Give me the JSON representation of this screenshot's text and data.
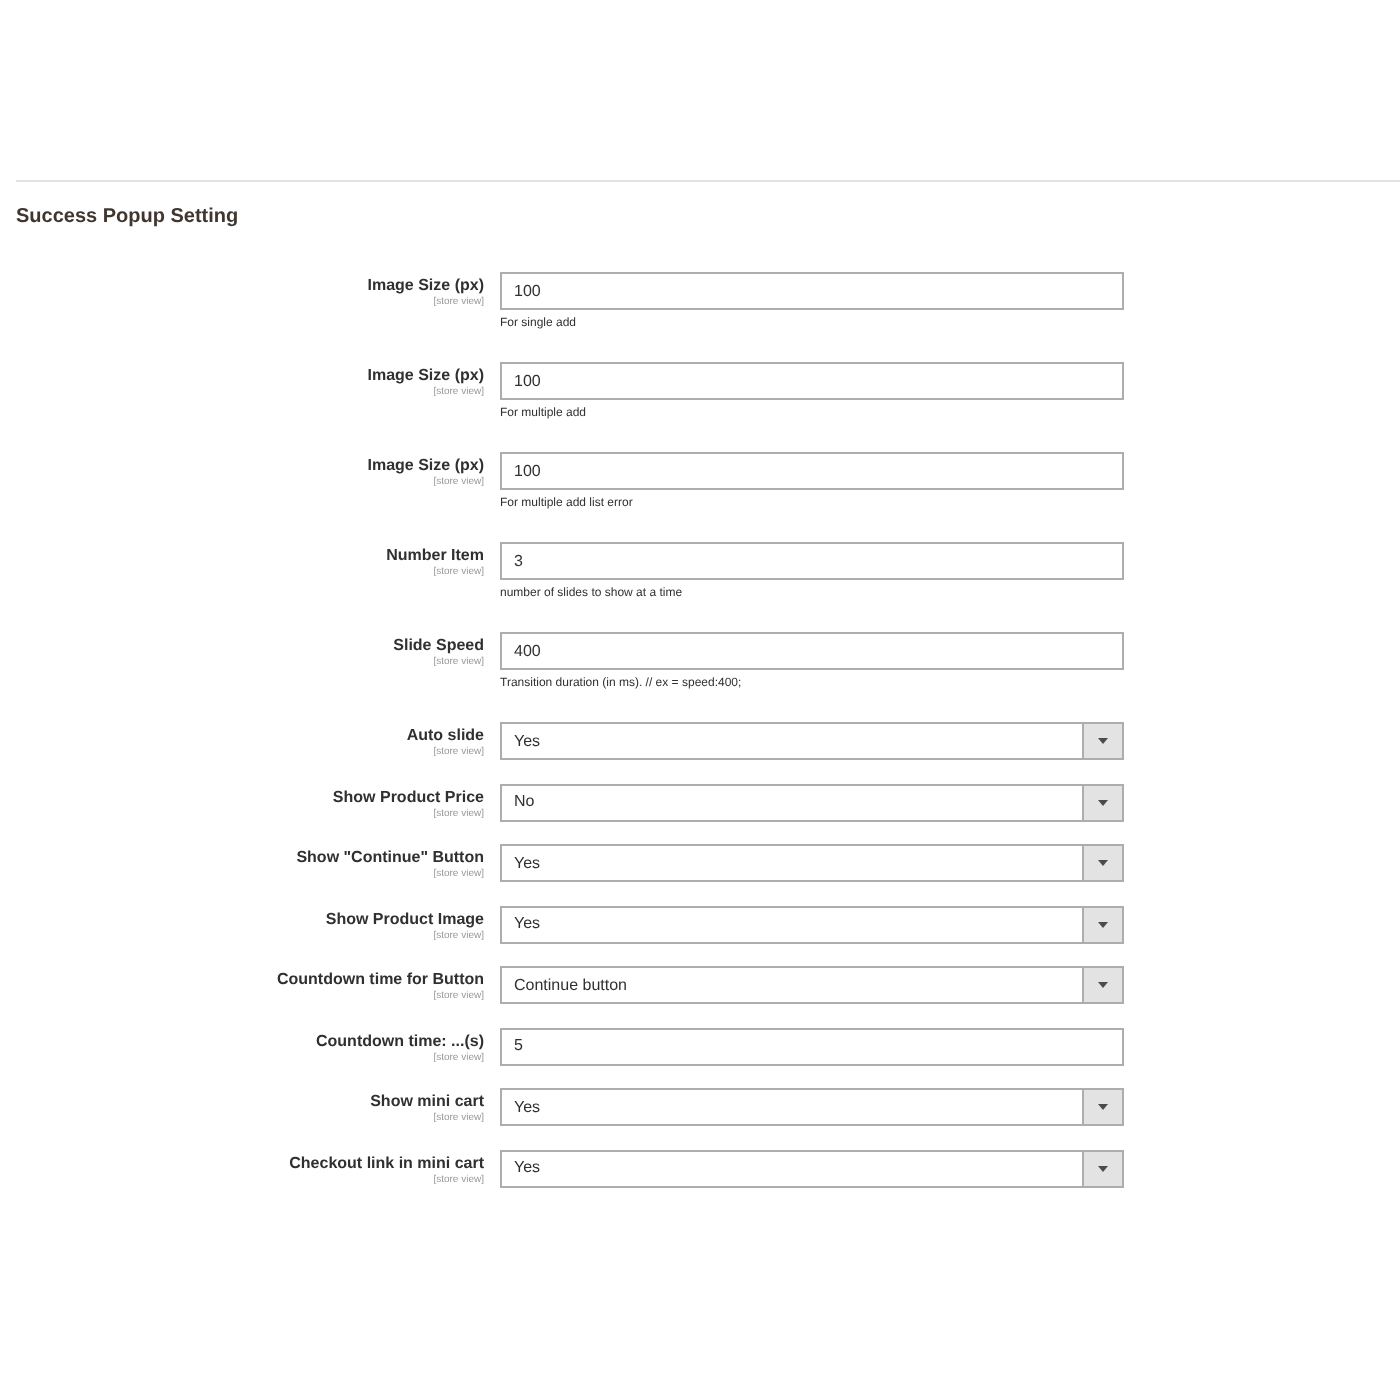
{
  "section": {
    "title": "Success Popup Setting"
  },
  "fields": [
    {
      "kind": "text",
      "label": "Image Size (px)",
      "scope": "[store view]",
      "value": "100",
      "note": "For single add"
    },
    {
      "kind": "text",
      "label": "Image Size (px)",
      "scope": "[store view]",
      "value": "100",
      "note": "For multiple add"
    },
    {
      "kind": "text",
      "label": "Image Size (px)",
      "scope": "[store view]",
      "value": "100",
      "note": "For multiple add list error"
    },
    {
      "kind": "text",
      "label": "Number Item",
      "scope": "[store view]",
      "value": "3",
      "note": "number of slides to show at a time"
    },
    {
      "kind": "text",
      "label": "Slide Speed",
      "scope": "[store view]",
      "value": "400",
      "note": "Transition duration (in ms). // ex = speed:400;"
    },
    {
      "kind": "select",
      "label": "Auto slide",
      "scope": "[store view]",
      "value": "Yes"
    },
    {
      "kind": "select",
      "label": "Show Product Price",
      "scope": "[store view]",
      "value": "No"
    },
    {
      "kind": "select",
      "label": "Show \"Continue\" Button",
      "scope": "[store view]",
      "value": "Yes"
    },
    {
      "kind": "select",
      "label": "Show Product Image",
      "scope": "[store view]",
      "value": "Yes"
    },
    {
      "kind": "select",
      "label": "Countdown time for Button",
      "scope": "[store view]",
      "value": "Continue button"
    },
    {
      "kind": "text",
      "label": "Countdown time: ...(s)",
      "scope": "[store view]",
      "value": "5"
    },
    {
      "kind": "select",
      "label": "Show mini cart",
      "scope": "[store view]",
      "value": "Yes"
    },
    {
      "kind": "select",
      "label": "Checkout link in mini cart",
      "scope": "[store view]",
      "value": "Yes"
    }
  ]
}
